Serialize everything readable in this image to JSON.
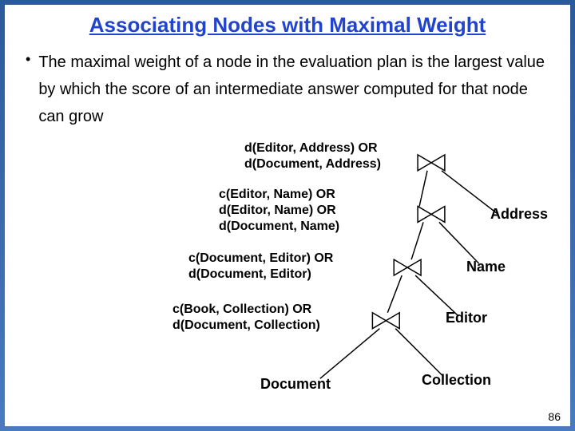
{
  "title": "Associating Nodes with Maximal Weight",
  "bullet": "The maximal weight of a node in the evaluation plan is the largest value by which the score of an intermediate answer computed for that node can grow",
  "labels": {
    "n1": "d(Editor, Address) OR\nd(Document, Address)",
    "n2": "c(Editor, Name) OR\nd(Editor, Name) OR\nd(Document, Name)",
    "n3": "c(Document, Editor) OR\nd(Document, Editor)",
    "n4": "c(Book, Collection) OR\nd(Document, Collection)"
  },
  "leaves": {
    "address": "Address",
    "name": "Name",
    "editor": "Editor",
    "collection": "Collection",
    "document": "Document"
  },
  "pageNumber": "86"
}
